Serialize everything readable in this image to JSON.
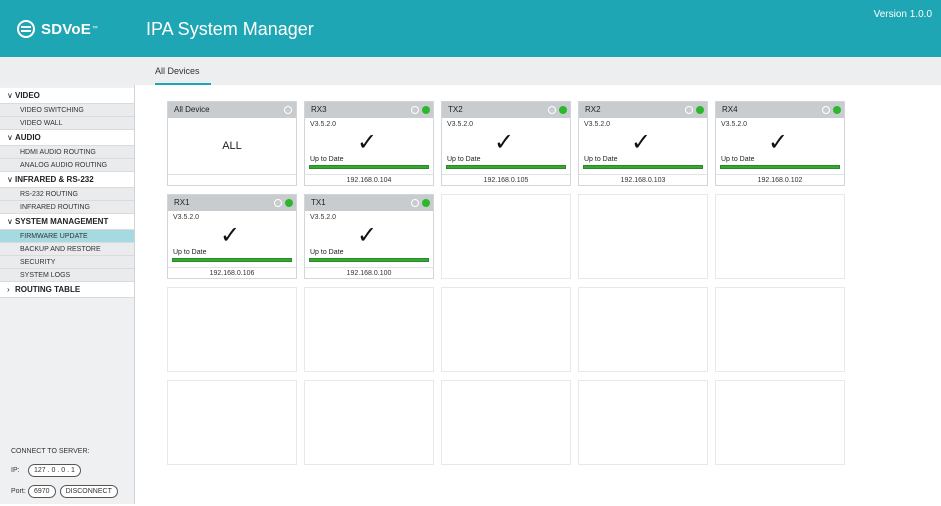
{
  "header": {
    "logo_text": "SDVoE",
    "logo_tm": "™",
    "app_title": "IPA System Manager",
    "version": "Version 1.0.0"
  },
  "tabs": [
    {
      "label": "All Devices",
      "active": true
    }
  ],
  "sidebar": {
    "sections": [
      {
        "label": "VIDEO",
        "expanded": true,
        "items": [
          {
            "label": "VIDEO SWITCHING"
          },
          {
            "label": "VIDEO WALL"
          }
        ]
      },
      {
        "label": "AUDIO",
        "expanded": true,
        "items": [
          {
            "label": "HDMI AUDIO ROUTING"
          },
          {
            "label": "ANALOG AUDIO ROUTING"
          }
        ]
      },
      {
        "label": "INFRARED & RS-232",
        "expanded": true,
        "items": [
          {
            "label": "RS-232 ROUTING"
          },
          {
            "label": "INFRARED ROUTING"
          }
        ]
      },
      {
        "label": "SYSTEM MANAGEMENT",
        "expanded": true,
        "items": [
          {
            "label": "FIRMWARE UPDATE",
            "active": true
          },
          {
            "label": "BACKUP AND RESTORE"
          },
          {
            "label": "SECURITY"
          },
          {
            "label": "SYSTEM LOGS"
          }
        ]
      },
      {
        "label": "ROUTING TABLE",
        "expanded": false,
        "items": []
      }
    ],
    "connect": {
      "title": "CONNECT TO SERVER:",
      "ip_label": "IP:",
      "ip_value": "127 . 0 . 0 . 1",
      "port_label": "Port:",
      "port_value": "6970",
      "disconnect_label": "DISCONNECT"
    }
  },
  "all_device": {
    "name": "All Device",
    "body": "ALL"
  },
  "devices": [
    {
      "name": "RX3",
      "version": "V3.5.2.0",
      "status": "Up to Date",
      "ip": "192.168.0.104"
    },
    {
      "name": "TX2",
      "version": "V3.5.2.0",
      "status": "Up to Date",
      "ip": "192.168.0.105"
    },
    {
      "name": "RX2",
      "version": "V3.5.2.0",
      "status": "Up to Date",
      "ip": "192.168.0.103"
    },
    {
      "name": "RX4",
      "version": "V3.5.2.0",
      "status": "Up to Date",
      "ip": "192.168.0.102"
    },
    {
      "name": "RX1",
      "version": "V3.5.2.0",
      "status": "Up to Date",
      "ip": "192.168.0.106"
    },
    {
      "name": "TX1",
      "version": "V3.5.2.0",
      "status": "Up to Date",
      "ip": "192.168.0.100"
    }
  ],
  "colors": {
    "accent": "#1fa6b4",
    "online": "#2cb82c",
    "progress": "#35a832",
    "active_nav": "#a5dbe0"
  },
  "icons": {
    "logo": "sdvoe-logo-icon",
    "device_status": "online-dot-icon",
    "device_select": "select-ring-icon",
    "update_done": "checkmark-icon",
    "section_toggle": "chevron-icon"
  }
}
